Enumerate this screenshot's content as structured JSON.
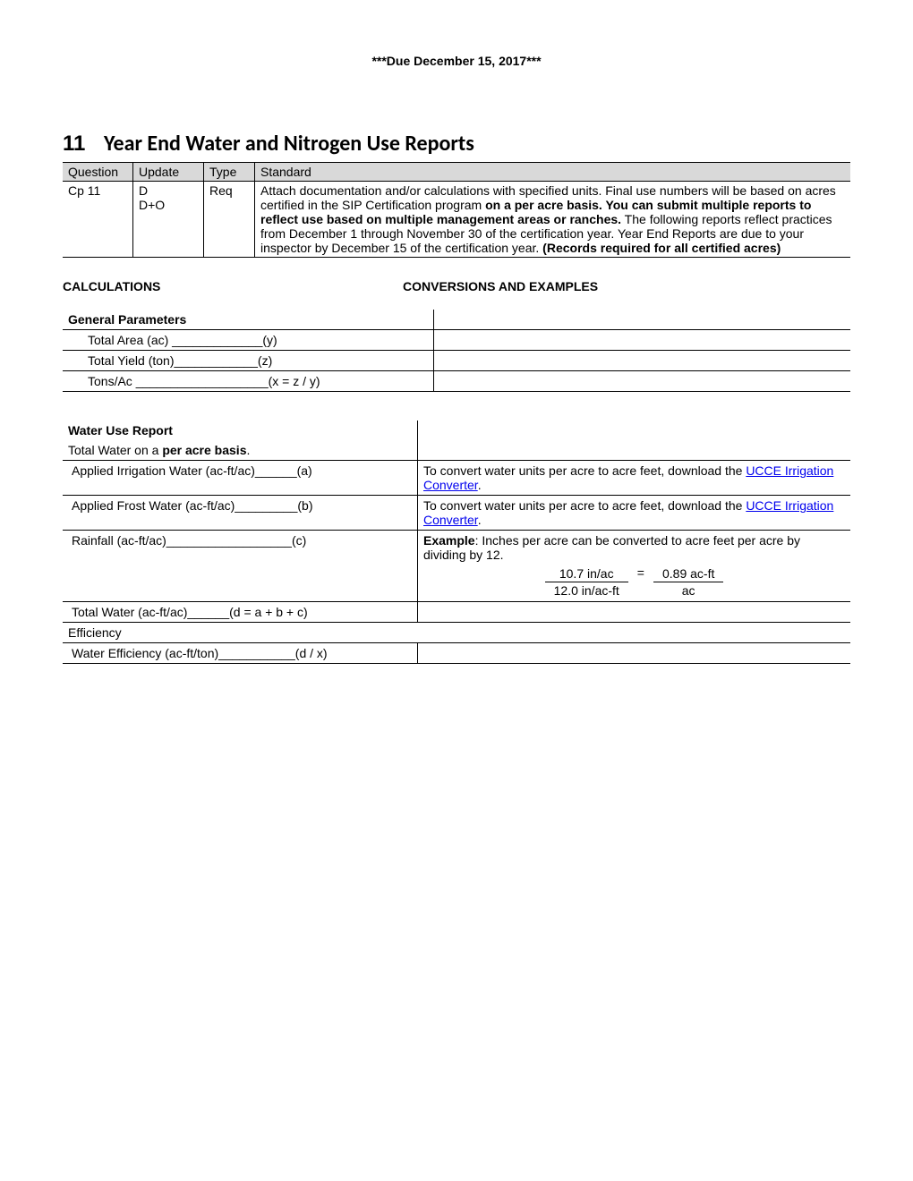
{
  "banner": "***Due December 15, 2017***",
  "section": {
    "num": "11",
    "title": "Year End Water and Nitrogen Use Reports"
  },
  "header_table": {
    "cols": {
      "c1": "Question",
      "c2": "Update",
      "c3": "Type",
      "c4": "Standard"
    },
    "row": {
      "question": "Cp 11",
      "update1": "D",
      "update2": "D+O",
      "type": "Req",
      "std_p1": "Attach documentation and/or calculations with specified units. Final use numbers will be based on acres certified in the SIP Certification program ",
      "std_b1": "on a per acre basis. You can submit multiple reports to reflect use based on multiple management areas or ranches.",
      "std_p2": " The following reports reflect practices from December 1 through November 30 of the certification year. Year End Reports are due to your inspector by December 15 of the certification year. ",
      "std_b2": "(Records required for all certified acres)"
    }
  },
  "colheads": {
    "left": "CALCULATIONS",
    "right": "CONVERSIONS AND EXAMPLES"
  },
  "general": {
    "title": "General Parameters",
    "r1": "Total Area (ac) _____________(y)",
    "r2": "Total Yield (ton)____________(z)",
    "r3": "Tons/Ac ___________________(x = z / y)"
  },
  "water": {
    "title": "Water Use Report",
    "basis_pre": "Total Water on a ",
    "basis_bold": "per acre basis",
    "basis_post": ".",
    "r1_l": "Applied Irrigation Water (ac-ft/ac)______(a)",
    "r1_r_pre": "To convert water units per acre to acre feet, download the ",
    "r1_r_link": "UCCE Irrigation Converter",
    "r1_r_post": ".",
    "r2_l": "Applied Frost Water (ac-ft/ac)_________(b)",
    "r3_l": "Rainfall (ac-ft/ac)__________________(c)",
    "r3_r_b": "Example",
    "r3_r_txt": ": Inches per acre can be converted to acre feet per acre by dividing by 12.",
    "frac": {
      "num_l": "10.7 in/ac",
      "den_l": "12.0 in/ac-ft",
      "eq": "=",
      "num_r": "0.89 ac-ft",
      "den_r": "ac"
    },
    "r4_l": "Total Water (ac-ft/ac)______(d = a + b + c)",
    "eff": "Efficiency",
    "r5_l": "Water Efficiency (ac-ft/ton)___________(d / x)"
  }
}
